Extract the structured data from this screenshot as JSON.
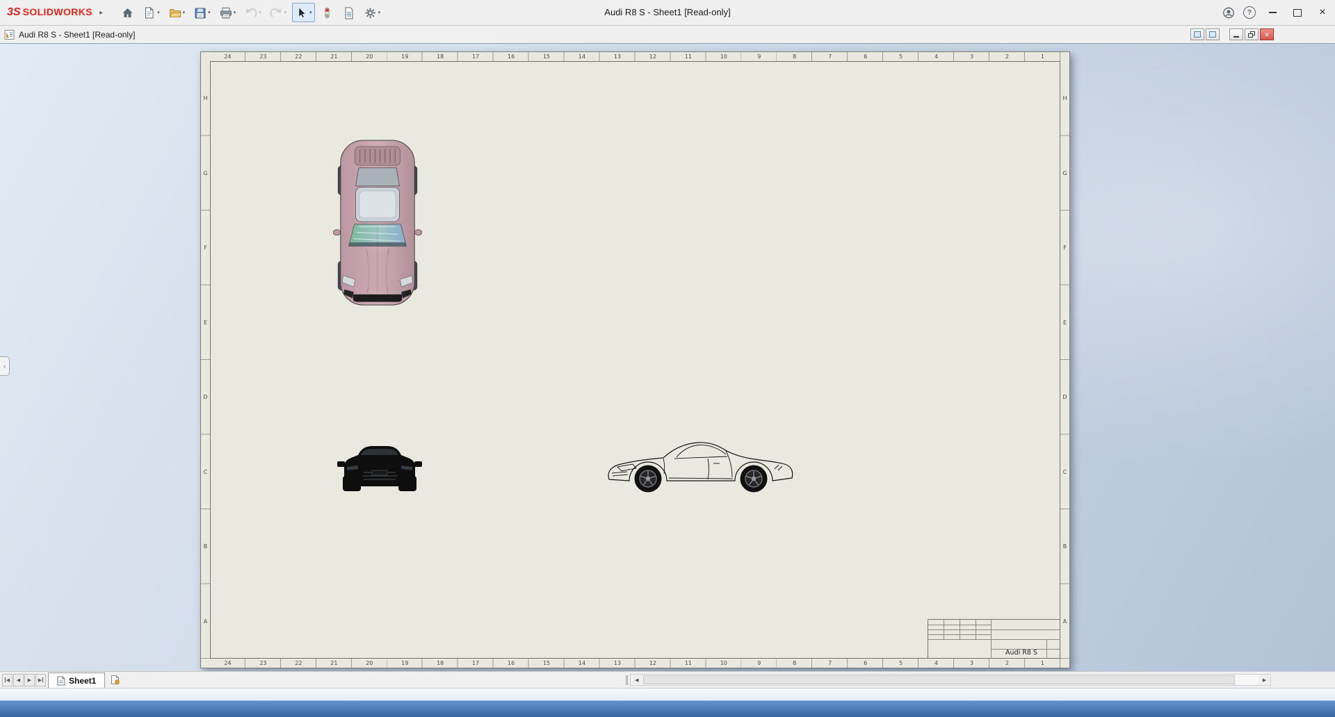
{
  "titlebar": {
    "brand_glyph": "3S",
    "brand_name": "SOLIDWORKS",
    "title": "Audi R8 S - Sheet1 [Read-only]"
  },
  "child_window": {
    "title": "Audi R8 S - Sheet1 [Read-only]"
  },
  "drawing": {
    "zones_horizontal": [
      "24",
      "23",
      "22",
      "21",
      "20",
      "19",
      "18",
      "17",
      "16",
      "15",
      "14",
      "13",
      "12",
      "11",
      "10",
      "9",
      "8",
      "7",
      "6",
      "5",
      "4",
      "3",
      "2",
      "1"
    ],
    "zones_vertical": [
      "H",
      "G",
      "F",
      "E",
      "D",
      "C",
      "B",
      "A"
    ],
    "title_block": {
      "part_title": "Audi R8 S"
    }
  },
  "sheet_bar": {
    "active_tab": "Sheet1"
  },
  "icons": {
    "menu_expand": "▸",
    "dropdown": "▾",
    "help": "?",
    "close": "×",
    "first_sheet": "◀",
    "prev_sheet": "◀",
    "next_sheet": "▶",
    "last_sheet": "▶",
    "scroll_left": "◀",
    "scroll_right": "▶",
    "flyout_collapse": "‹"
  },
  "colors": {
    "brand_red": "#e2231a",
    "paper": "#e9e9e0",
    "viewport_light": "#e2eaf4",
    "viewport_dark": "#b3c3d8",
    "close_red": "#d9534a",
    "status_strip_top": "#6593cd",
    "status_strip_bottom": "#38649f",
    "car_body_pink": "#c5a3ad",
    "glass_green": "#7db89b",
    "glass_blue": "#86aecb"
  }
}
